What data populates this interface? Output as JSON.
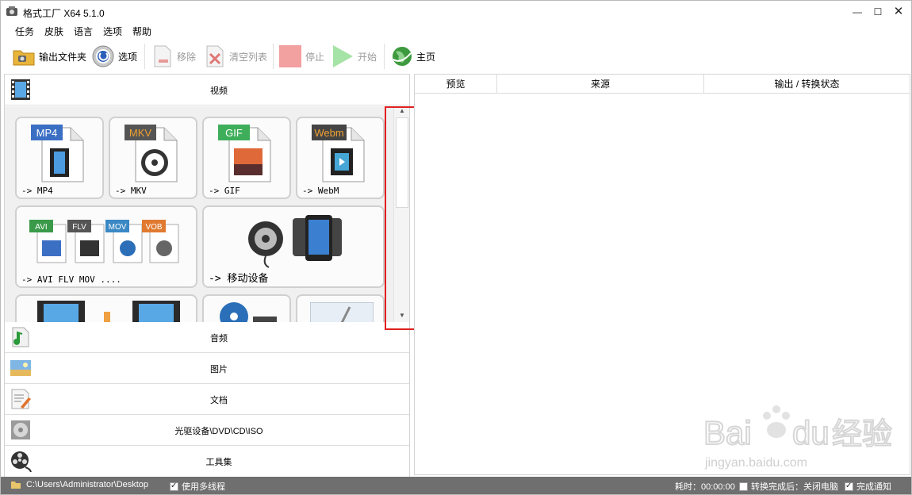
{
  "window": {
    "title": "格式工厂 X64 5.1.0"
  },
  "menu": [
    "任务",
    "皮肤",
    "语言",
    "选项",
    "帮助"
  ],
  "toolbar": {
    "output_folder": "输出文件夹",
    "options": "选项",
    "remove": "移除",
    "clear_list": "清空列表",
    "stop": "停止",
    "start": "开始",
    "home": "主页"
  },
  "categories": {
    "video": "视频",
    "audio": "音频",
    "image": "图片",
    "document": "文档",
    "optical": "光驱设备\\DVD\\CD\\ISO",
    "tools": "工具集"
  },
  "video_tiles": [
    {
      "label": "-> MP4",
      "badge": "MP4",
      "badge_color": "#3b6fc4"
    },
    {
      "label": "-> MKV",
      "badge": "MKV",
      "badge_color": "#555555"
    },
    {
      "label": "-> GIF",
      "badge": "GIF",
      "badge_color": "#3fae5a"
    },
    {
      "label": "-> WebM",
      "badge": "Webm",
      "badge_color": "#444444"
    },
    {
      "label": "-> AVI FLV MOV ....",
      "badges": [
        "AVI",
        "FLV",
        "MOV",
        "VOB"
      ]
    },
    {
      "label": "-> 移动设备"
    }
  ],
  "table": {
    "columns": [
      "预览",
      "来源",
      "输出 / 转换状态"
    ]
  },
  "status": {
    "path": "C:\\Users\\Administrator\\Desktop",
    "multithread": "使用多线程",
    "elapsed": "耗时：00:00:00",
    "after_done": "转换完成后：关闭电脑",
    "notify": "完成通知"
  },
  "watermark": {
    "brand": "Bai",
    "brand2": "du",
    "cn": "经验",
    "url": "jingyan.baidu.com"
  },
  "colors": {
    "statusbar": "#6f6f6f",
    "highlight": "#e02020"
  }
}
